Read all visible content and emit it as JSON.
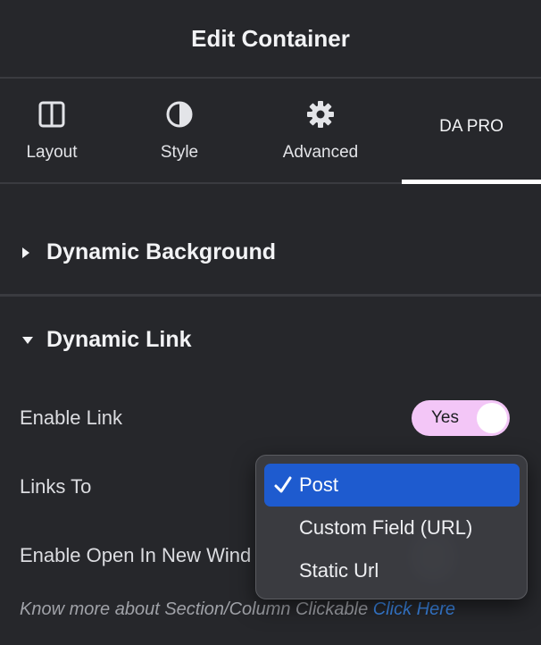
{
  "header": {
    "title": "Edit Container"
  },
  "tabs": [
    {
      "label": "Layout",
      "icon": "layout-columns-icon"
    },
    {
      "label": "Style",
      "icon": "half-circle-contrast-icon"
    },
    {
      "label": "Advanced",
      "icon": "gear-icon"
    },
    {
      "label": "DA PRO",
      "active": true
    }
  ],
  "sections": {
    "dynamic_background": {
      "title": "Dynamic Background",
      "expanded": false
    },
    "dynamic_link": {
      "title": "Dynamic Link",
      "expanded": true
    }
  },
  "fields": {
    "enable_link": {
      "label": "Enable Link",
      "toggle_label": "Yes",
      "value": true
    },
    "links_to": {
      "label": "Links To",
      "selected": "Post"
    },
    "open_new_window": {
      "label": "Enable Open In New Wind"
    }
  },
  "dropdown": {
    "options": [
      {
        "label": "Post",
        "selected": true
      },
      {
        "label": "Custom Field (URL)",
        "selected": false
      },
      {
        "label": "Static Url",
        "selected": false
      }
    ]
  },
  "note": {
    "text": "Know more about Section/Column Clickable",
    "link": "Click Here"
  },
  "colors": {
    "background": "#26272b",
    "toggle": "#f3c6f7",
    "selected_option": "#1e5bcf",
    "link": "#3b86e5"
  }
}
